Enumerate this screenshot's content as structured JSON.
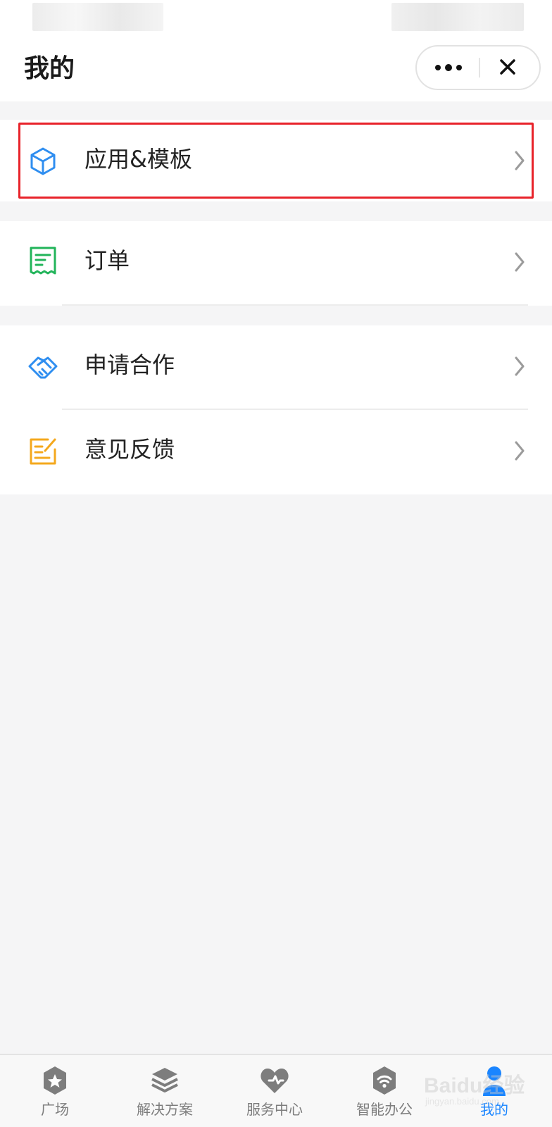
{
  "header": {
    "title": "我的"
  },
  "menu": {
    "app_templates": {
      "label": "应用&模板",
      "icon": "cube-icon",
      "color": "#2f8ef0"
    },
    "orders": {
      "label": "订单",
      "icon": "receipt-icon",
      "color": "#22b45a"
    },
    "partnership": {
      "label": "申请合作",
      "icon": "handshake-icon",
      "color": "#2f8ef0"
    },
    "feedback": {
      "label": "意见反馈",
      "icon": "edit-note-icon",
      "color": "#f4a81d"
    }
  },
  "tabbar": {
    "items": [
      {
        "label": "广场",
        "icon": "star-badge-icon",
        "active": false
      },
      {
        "label": "解决方案",
        "icon": "layers-icon",
        "active": false
      },
      {
        "label": "服务中心",
        "icon": "heart-icon",
        "active": false
      },
      {
        "label": "智能办公",
        "icon": "wifi-shield-icon",
        "active": false
      },
      {
        "label": "我的",
        "icon": "user-dot-icon",
        "active": true
      }
    ],
    "active_color": "#1a85ff",
    "inactive_color": "#7d7d7d"
  },
  "watermark": {
    "brand": "Baidu经验",
    "url": "jingyan.baidu.com"
  },
  "colors": {
    "highlight": "#e8232a",
    "background": "#f5f5f6"
  }
}
